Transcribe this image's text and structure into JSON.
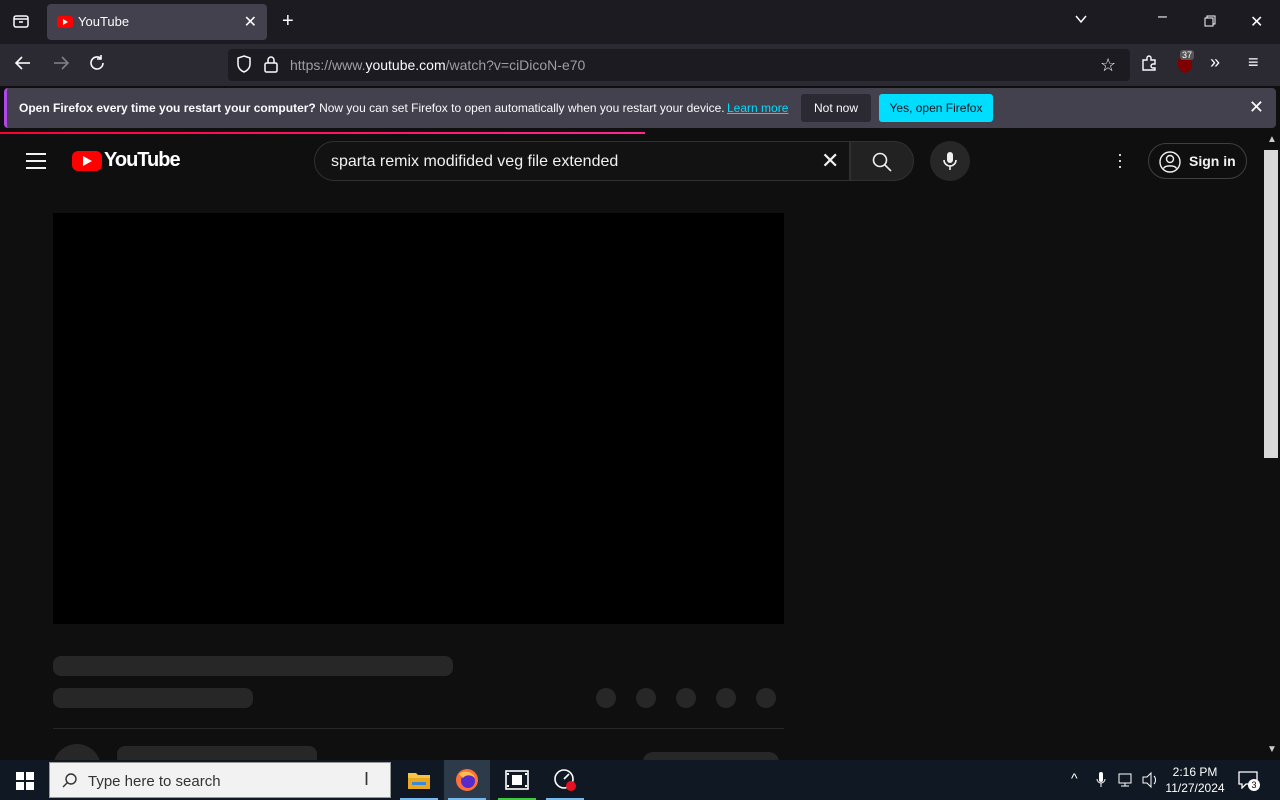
{
  "browser": {
    "tab_title": "YouTube",
    "url_prefix": "https://www.",
    "url_host": "youtube.com",
    "url_path": "/watch?v=ciDicoN-e70",
    "extension_badge": "37"
  },
  "notification": {
    "bold_text": "Open Firefox every time you restart your computer?",
    "text": " Now you can set Firefox to open automatically when you restart your device.",
    "learn_more": "Learn more",
    "not_now": "Not now",
    "yes": "Yes, open Firefox"
  },
  "youtube": {
    "logo_text": "YouTube",
    "search_query": "sparta remix modifided veg file extended",
    "sign_in": "Sign in"
  },
  "taskbar": {
    "search_placeholder": "Type here to search",
    "time": "2:16 PM",
    "date": "11/27/2024",
    "notification_count": "3"
  },
  "colors": {
    "youtube_red": "#ff0000",
    "firefox_accent": "#00ddff"
  }
}
